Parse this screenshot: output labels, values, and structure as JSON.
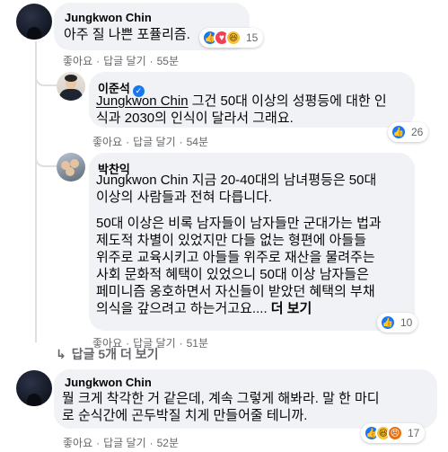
{
  "comments": [
    {
      "author": "Jungkwon Chin",
      "lines": [
        "아주 질 나쁜 포퓰리즘."
      ],
      "reactions": {
        "icons": [
          "like-icon",
          "love-icon",
          "haha-icon"
        ],
        "count": "15"
      },
      "actions": {
        "like": "좋아요",
        "reply": "답글 달기",
        "time": "55분"
      }
    },
    {
      "author": "이준석",
      "verified": true,
      "mention": "Jungkwon Chin",
      "lines": [
        " 그건 50대 이상의 성평등에 대한 인",
        "식과 2030의 인식이 달라서 그래요."
      ],
      "reactions": {
        "icons": [
          "like-icon"
        ],
        "count": "26"
      },
      "actions": {
        "like": "좋아요",
        "reply": "답글 달기",
        "time": "54분"
      }
    },
    {
      "author": "박찬익",
      "mention": "Jungkwon Chin",
      "lines": [
        " 지금 20-40대의 남녀평등은 50대",
        "이상의 사람들과 전혀 다릅니다."
      ],
      "paragraph": [
        "50대 이상은 비록 남자들이 남자들만 군대가는 법과",
        "제도적 차별이 있었지만 다들 없는 형편에 아들들",
        "위주로 교육시키고 아들들 위주로 재산을 물려주는",
        "사회 문화적 혜택이 있었으니 50대 이상 남자들은",
        "페미니즘 옹호하면서 자신들이 받았던 혜택의 부채",
        "의식을 갚으려고 하는거고요...."
      ],
      "more": "더 보기",
      "reactions": {
        "icons": [
          "like-icon"
        ],
        "count": "10"
      },
      "actions": {
        "like": "좋아요",
        "reply": "답글 달기",
        "time": "51분"
      }
    },
    {
      "author": "Jungkwon Chin",
      "lines": [
        "뭘 크게 착각한 거 같은데, 계속 그렇게 해봐라. 말 한 마디",
        "로 순식간에 곤두박질 치게 만들어줄 테니까."
      ],
      "reactions": {
        "icons": [
          "like-icon",
          "haha-icon",
          "angry-icon"
        ],
        "count": "17"
      },
      "actions": {
        "like": "좋아요",
        "reply": "답글 달기",
        "time": "52분"
      }
    }
  ],
  "more_replies": "답글 5개 더 보기"
}
